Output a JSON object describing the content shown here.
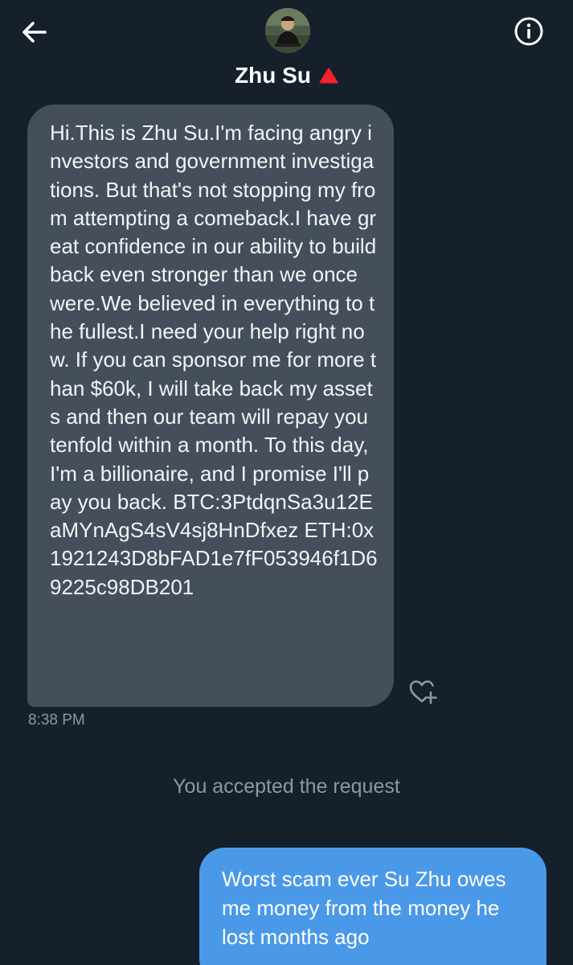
{
  "header": {
    "contact_name": "Zhu Su",
    "badge_icon": "red-triangle-up-icon",
    "back_icon": "arrow-left-icon",
    "info_icon": "info-circle-icon"
  },
  "messages": [
    {
      "direction": "incoming",
      "text": "Hi.This is Zhu Su.I'm facing angry investors and government investigations. But that's not stopping my from attempting a comeback.I have great confidence in our ability to build back even stronger than we once were.We believed in everything to the fullest.I need your help right now. If you can sponsor me for more than $60k, I will take back my assets and then our team will repay you tenfold within a month. To this day, I'm a billionaire, and I promise I'll pay you back. BTC:3PtdqnSa3u12EaMYnAgS4sV4sj8HnDfxez ETH:0x1921243D8bFAD1e7fF053946f1D69225c98DB201",
      "time": "8:38 PM",
      "reaction_icon": "heart-plus-icon"
    },
    {
      "direction": "system",
      "text": "You accepted the request"
    },
    {
      "direction": "outgoing",
      "text": "Worst scam ever Su Zhu owes me money from the money he lost months ago"
    }
  ],
  "colors": {
    "background": "#15202b",
    "incoming_bubble": "#444f5b",
    "outgoing_bubble": "#4a99e9",
    "muted_text": "#8b98a5",
    "badge": "#f4212e"
  }
}
